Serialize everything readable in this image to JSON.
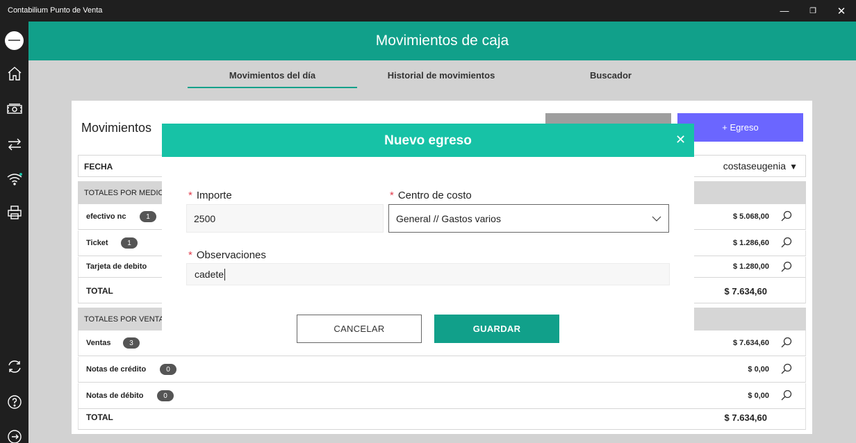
{
  "window": {
    "title": "Contabilium Punto de Venta",
    "minimize_glyph": "—",
    "maximize_glyph": "❐",
    "close_glyph": "✕"
  },
  "rail": {
    "items": [
      {
        "icon": "home-icon"
      },
      {
        "icon": "cash-icon"
      },
      {
        "icon": "transfer-arrows-icon"
      },
      {
        "icon": "wifi-icon"
      },
      {
        "icon": "printer-icon"
      },
      {
        "icon": "sync-icon"
      },
      {
        "icon": "help-icon"
      },
      {
        "icon": "logout-icon"
      }
    ]
  },
  "header": {
    "title": "Movimientos de caja"
  },
  "tabs": [
    {
      "label": "Movimientos del día",
      "active": true
    },
    {
      "label": "Historial de movimientos",
      "active": false
    },
    {
      "label": "Buscador",
      "active": false
    }
  ],
  "card": {
    "title": "Movimientos",
    "egreso_button": "+ Egreso",
    "filter": {
      "fecha_label": "FECHA",
      "user": "costaseugenia",
      "caret": "▼"
    },
    "section_medio": {
      "label": "TOTALES POR MEDIO D",
      "rows": [
        {
          "name": "efectivo nc",
          "count": "1",
          "amount": "$ 5.068,00"
        },
        {
          "name": "Ticket",
          "count": "1",
          "amount": "$ 1.286,60"
        },
        {
          "name": "Tarjeta de debito",
          "count": "",
          "amount": "$ 1.280,00"
        }
      ],
      "total_label": "TOTAL",
      "total_amount": "$ 7.634,60"
    },
    "section_venta": {
      "label": "TOTALES POR VENTA",
      "rows": [
        {
          "name": "Ventas",
          "count": "3",
          "amount": "$ 7.634,60"
        },
        {
          "name": "Notas de crédito",
          "count": "0",
          "amount": "$ 0,00"
        },
        {
          "name": "Notas de débito",
          "count": "0",
          "amount": "$ 0,00"
        }
      ],
      "total_label": "TOTAL",
      "total_amount": "$ 7.634,60"
    }
  },
  "dialog": {
    "title": "Nuevo egreso",
    "close_glyph": "✕",
    "required_mark": "*",
    "importe_label": "Importe",
    "importe_value": "2500",
    "centro_label": "Centro de costo",
    "centro_value": "General // Gastos varios",
    "obs_label": "Observaciones",
    "obs_value": "cadete",
    "cancel_label": "CANCELAR",
    "save_label": "GUARDAR"
  },
  "colors": {
    "accent": "#11a08a",
    "dialog_header": "#17c2a6",
    "egreso_button": "#6b66ff",
    "required": "#e23c4c"
  }
}
